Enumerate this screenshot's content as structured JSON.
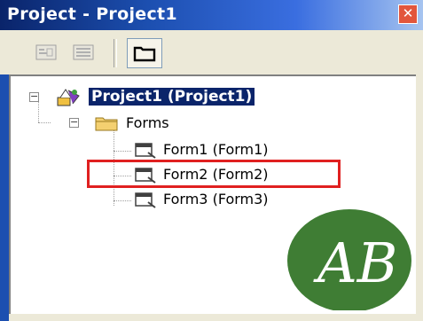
{
  "window": {
    "title": "Project - Project1",
    "close_glyph": "✕"
  },
  "toolbar": {
    "buttons": [
      {
        "name": "view-code-button",
        "icon": "view-code-icon"
      },
      {
        "name": "view-object-button",
        "icon": "view-object-icon"
      },
      {
        "name": "toggle-folders-button",
        "icon": "folder-icon"
      }
    ]
  },
  "tree": {
    "root": {
      "label": "Project1 (Project1)",
      "icon": "project-icon",
      "expander": "−"
    },
    "folder": {
      "label": "Forms",
      "icon": "folder-icon",
      "expander": "−"
    },
    "items": [
      {
        "label": "Form1 (Form1)",
        "icon": "form-icon"
      },
      {
        "label": "Form2 (Form2)",
        "icon": "form-icon",
        "highlighted": true
      },
      {
        "label": "Form3 (Form3)",
        "icon": "form-icon"
      }
    ]
  },
  "colors": {
    "titlebar": "#0a246a",
    "selection": "#0a246a",
    "highlight": "#e02020",
    "logo": "#3f7d34"
  },
  "watermark": {
    "text": "AB",
    "icon": "ab-logo"
  }
}
